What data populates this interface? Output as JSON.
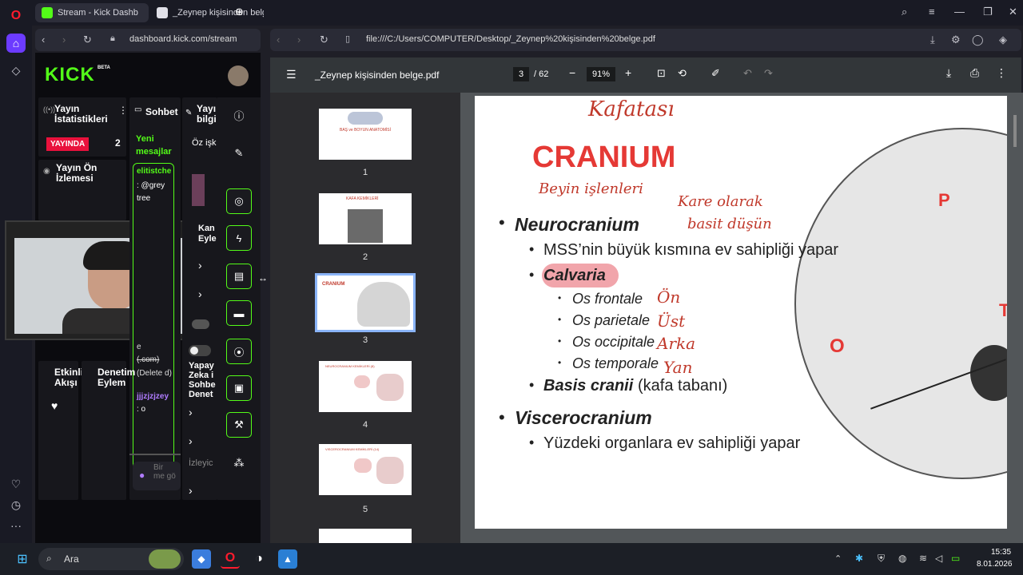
{
  "browser": {
    "tabs": [
      {
        "title": "Stream - Kick Dashb",
        "active": true
      },
      {
        "title": "_Zeynep kişisinden belg",
        "active": false
      }
    ],
    "kick_url": "dashboard.kick.com/stream",
    "pdf_url": "file:///C:/Users/COMPUTER/Desktop/_Zeynep%20kişisinden%20belge.pdf"
  },
  "kick": {
    "logo": "KICK",
    "logo_badge": "BETA",
    "stats": {
      "title": "Yayın İstatistikleri",
      "live_badge": "YAYINDA",
      "count": "2"
    },
    "preview": {
      "title": "Yayın Ön İzlemesi"
    },
    "chat": {
      "title": "Sohbet",
      "new_messages": "Yeni mesajlar",
      "username": "elitistche",
      "msg1": ": @grey tree",
      "deleted1": "e",
      "deleted2": "(.com)",
      "deleted3": "(Delete d)",
      "username2": "jjjzjzjzey",
      "msg2": ": o",
      "input_placeholder": "Bir me gö"
    },
    "col3": {
      "title": "Yayı bilgi",
      "item1": "Öz işk",
      "item2": "Kan Eyle",
      "item3": "Yapay Zeka i Sohbe Denet",
      "item4": "İzleyic"
    },
    "activity": {
      "title": "Etkinlik Akışı"
    },
    "mod": {
      "title": "Denetim Eylem"
    }
  },
  "pdf": {
    "filename": "_Zeynep kişisinden belge.pdf",
    "page_current": "3",
    "page_total": "/ 62",
    "zoom": "91%",
    "thumbs": [
      {
        "num": "1",
        "title": "BAŞ ve BOYUN ANATOMİSİ"
      },
      {
        "num": "2",
        "title": "KAFA KEMİKLERİ"
      },
      {
        "num": "3",
        "title": "CRANIUM"
      },
      {
        "num": "4",
        "title": "NEUROCRANIUM KEMİKLERİ (8)"
      },
      {
        "num": "5",
        "title": "VISCEROCRANIUM KEMİKLERİ (14)"
      }
    ],
    "slide": {
      "handwritten_title": "Kafatası",
      "title": "CRANIUM",
      "hw_beyin": "Beyin işlenleri",
      "hw_kare": "Kare olarak",
      "hw_basit": "basit düşün",
      "neuro": "Neurocranium",
      "neuro_sub": "MSS’nin büyük kısmına ev sahipliği yapar",
      "calvaria": "Calvaria",
      "os1": "Os frontale",
      "os2": "Os parietale",
      "os3": "Os occipitale",
      "os4": "Os temporale",
      "hw1": "Ön",
      "hw2": "Üst",
      "hw3": "Arka",
      "hw4": "Yan",
      "basis": "Basis cranii",
      "basis_sub": "(kafa tabanı)",
      "viscero": "Viscerocranium",
      "viscero_sub": "Yüzdeki organlara ev sahipliği yapar",
      "label_p": "P",
      "label_o": "O",
      "label_t": "T"
    }
  },
  "taskbar": {
    "search": "Ara",
    "time": "15:35",
    "date": "8.01.2026"
  }
}
